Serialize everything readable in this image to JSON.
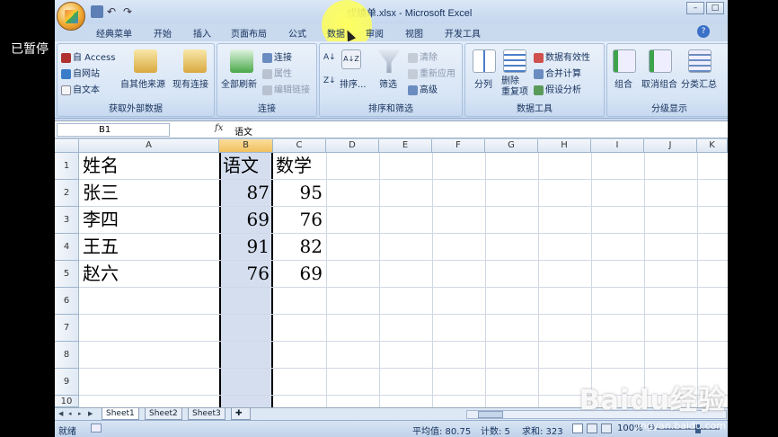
{
  "overlay": {
    "paused": "已暂停"
  },
  "window": {
    "title": "成绩单.xlsx - Microsoft Excel",
    "controls": [
      "–",
      "□"
    ]
  },
  "ribbon_tabs": [
    "经典菜单",
    "开始",
    "插入",
    "页面布局",
    "公式",
    "数据",
    "审阅",
    "视图",
    "开发工具"
  ],
  "active_tab": "数据",
  "groups": {
    "external": {
      "label": "获取外部数据",
      "access": "自 Access",
      "web": "自网站",
      "text": "自文本",
      "other": "自其他来源",
      "existing": "现有连接"
    },
    "connections": {
      "label": "连接",
      "refresh_all": "全部刷新",
      "connections": "连接",
      "properties": "属性",
      "edit_links": "编辑链接"
    },
    "sort_filter": {
      "label": "排序和筛选",
      "sort_az": "A↓Z",
      "sort": "排序...",
      "filter": "筛选",
      "clear": "清除",
      "reapply": "重新应用",
      "advanced": "高级"
    },
    "data_tools": {
      "label": "数据工具",
      "split": "分列",
      "remove_dup": "删除\n重复项",
      "validation": "数据有效性",
      "consolidate": "合并计算",
      "whatif": "假设分析"
    },
    "outline": {
      "label": "分级显示",
      "group": "组合",
      "ungroup": "取消组合",
      "subtotal": "分类汇总"
    }
  },
  "formula_bar": {
    "name_box": "B1",
    "fx": "fx",
    "value": "语文"
  },
  "columns": [
    "A",
    "B",
    "C",
    "D",
    "E",
    "F",
    "G",
    "H",
    "I",
    "J",
    "K"
  ],
  "rows": [
    "1",
    "2",
    "3",
    "4",
    "5",
    "6",
    "7",
    "8",
    "9",
    "10"
  ],
  "cells": {
    "A1": "姓名",
    "B1": "语文",
    "C1": "数学",
    "A2": "张三",
    "B2": "87",
    "C2": "95",
    "A3": "李四",
    "B3": "69",
    "C3": "76",
    "A4": "王五",
    "B4": "91",
    "C4": "82",
    "A5": "赵六",
    "B5": "76",
    "C5": "69"
  },
  "sheet_tabs": [
    "Sheet1",
    "Sheet2",
    "Sheet3"
  ],
  "status": {
    "ready": "就绪",
    "average": "平均值: 80.75",
    "count": "计数: 5",
    "sum": "求和: 323",
    "zoom": "100%"
  },
  "watermark": {
    "brand": "Baidu经验",
    "url": "jingyan.baidu.com"
  },
  "colors": {
    "accent": "#15315c",
    "selected_col": "#d4deef",
    "ribbon": "#d3e2f4"
  }
}
